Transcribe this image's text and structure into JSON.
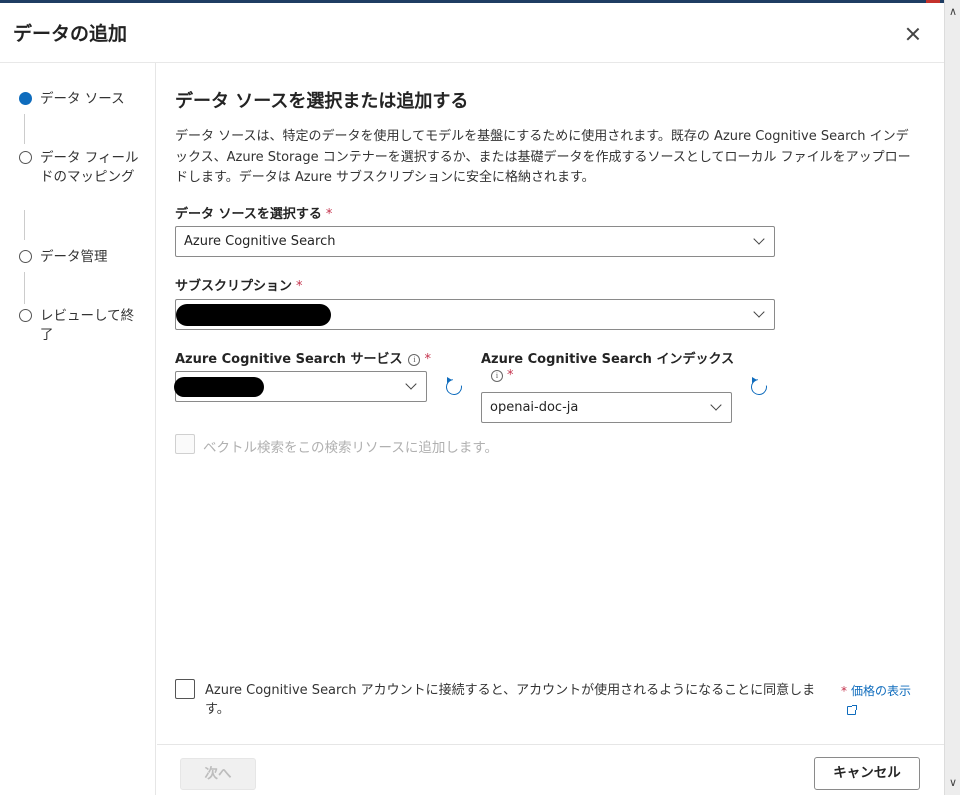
{
  "dialog": {
    "title": "データの追加",
    "close_label": "×"
  },
  "steps": [
    {
      "label": "データ ソース",
      "active": true
    },
    {
      "label": "データ フィールドのマッピング",
      "active": false
    },
    {
      "label": "データ管理",
      "active": false
    },
    {
      "label": "レビューして終了",
      "active": false
    }
  ],
  "main": {
    "title": "データ ソースを選択または追加する",
    "description": "データ ソースは、特定のデータを使用してモデルを基盤にするために使用されます。既存の Azure Cognitive Search インデックス、Azure Storage コンテナーを選択するか、または基礎データを作成するソースとしてローカル ファイルをアップロードします。データは Azure サブスクリプションに安全に格納されます。",
    "data_source": {
      "label": "データ ソースを選択する",
      "required": "*",
      "value": "Azure Cognitive Search"
    },
    "subscription": {
      "label": "サブスクリプション",
      "required": "*"
    },
    "search_service": {
      "label": "Azure Cognitive Search サービス",
      "info": "i",
      "required": "*"
    },
    "search_index": {
      "label": "Azure Cognitive Search インデックス",
      "info": "i",
      "required": "*",
      "value": "openai-doc-ja"
    },
    "vector_search": {
      "label": "ベクトル検索をこの検索リソースに追加します。"
    },
    "consent": {
      "label": "Azure Cognitive Search アカウントに接続すると、アカウントが使用されるようになることに同意します。",
      "required": "*",
      "pricing_link": "価格の表示"
    }
  },
  "footer": {
    "next_label": "次へ",
    "cancel_label": "キャンセル"
  },
  "colors": {
    "accent": "#0f6cbd",
    "required": "#c4314b"
  }
}
